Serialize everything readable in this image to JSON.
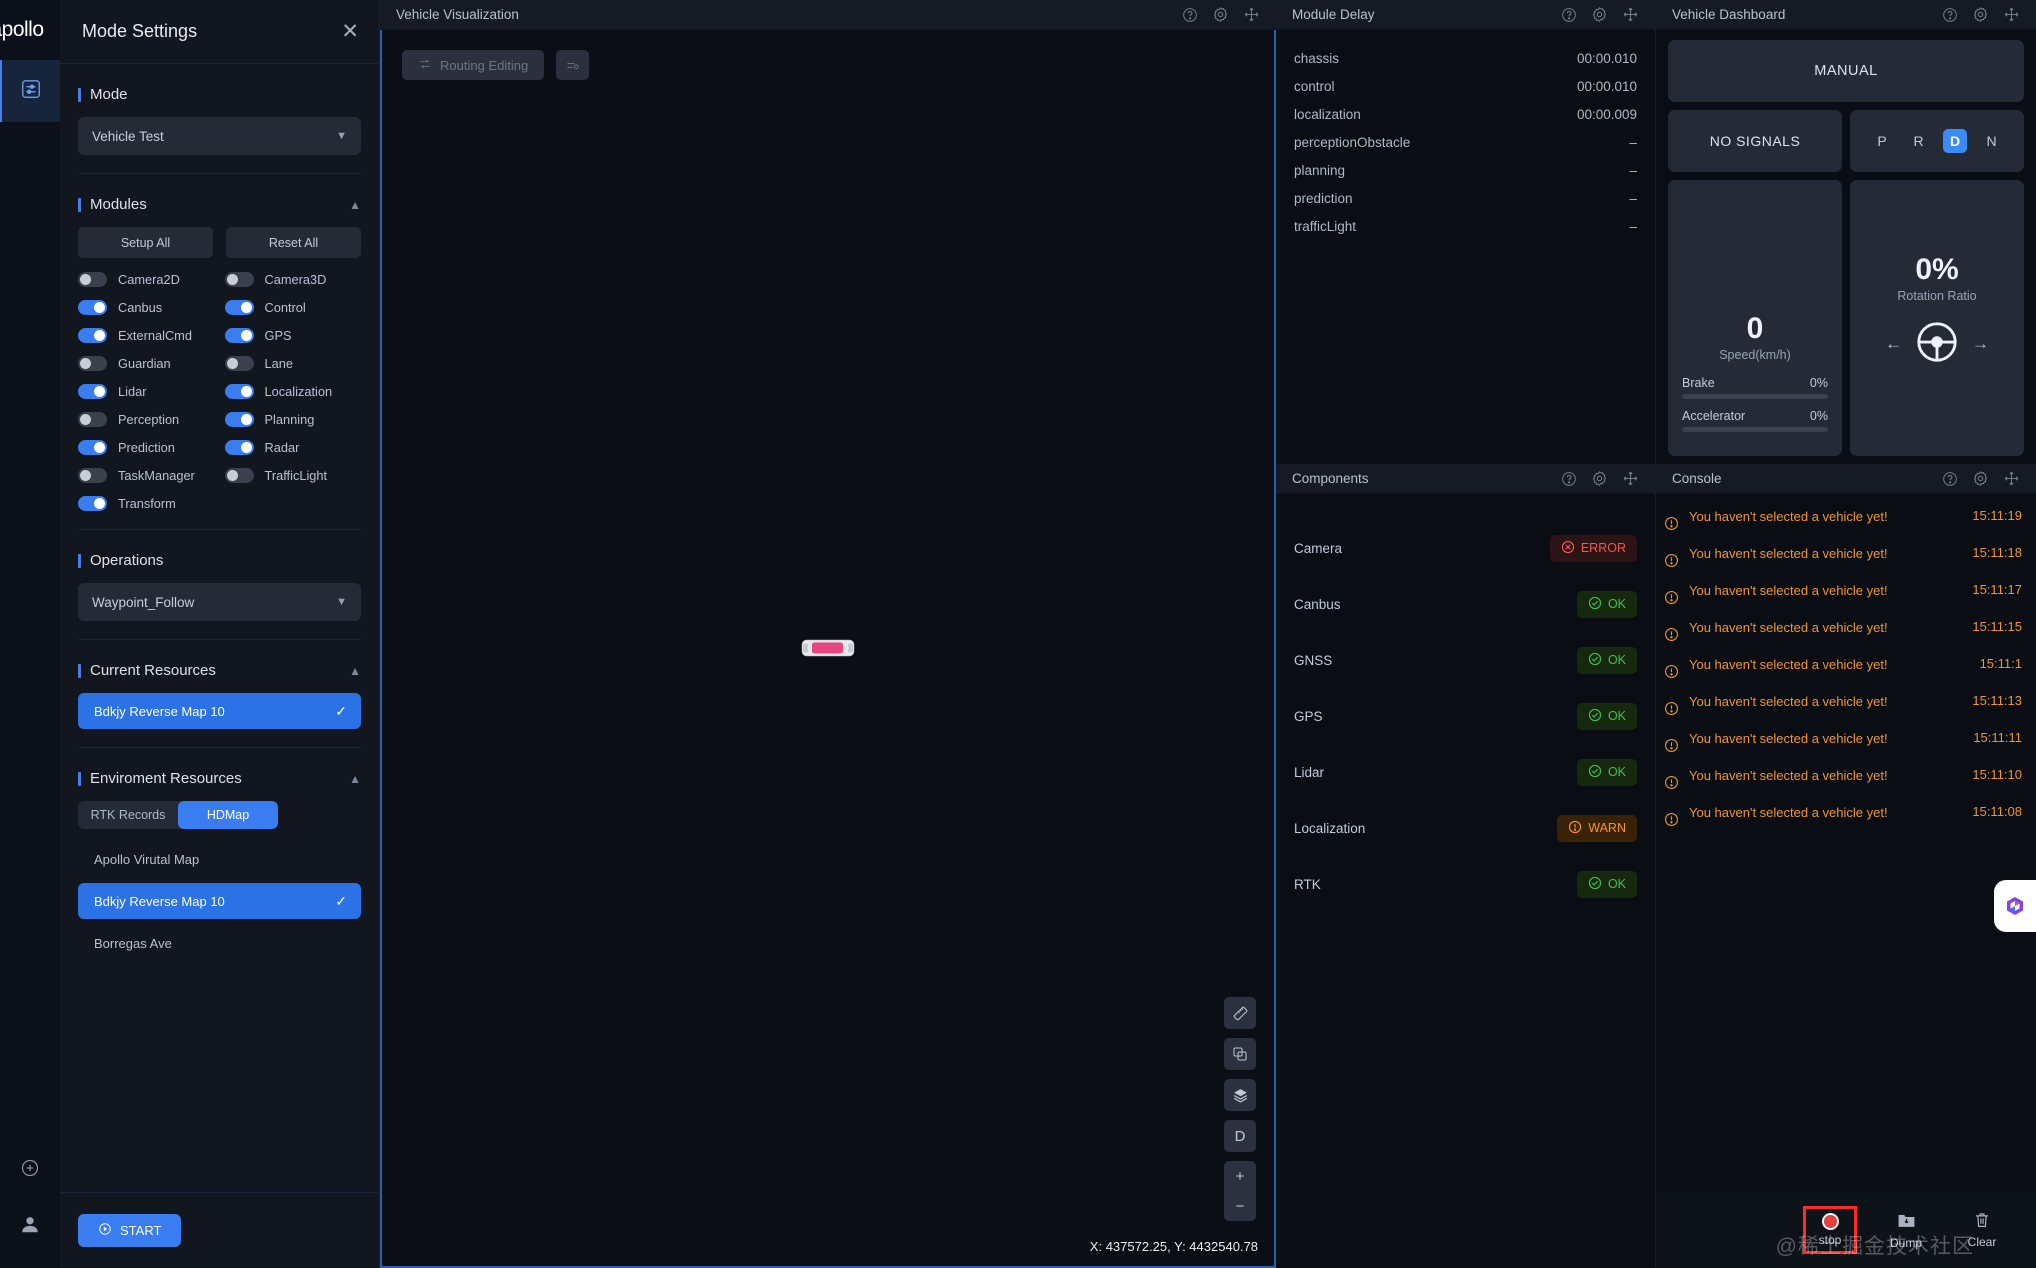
{
  "brand": {
    "logo_text": "apollo"
  },
  "settings": {
    "title": "Mode Settings",
    "close_icon": "close-icon",
    "mode": {
      "section_label": "Mode",
      "value": "Vehicle Test"
    },
    "modules": {
      "section_label": "Modules",
      "setup_all_label": "Setup All",
      "reset_all_label": "Reset All",
      "items": [
        {
          "label": "Camera2D",
          "on": false
        },
        {
          "label": "Camera3D",
          "on": false
        },
        {
          "label": "Canbus",
          "on": true
        },
        {
          "label": "Control",
          "on": true
        },
        {
          "label": "ExternalCmd",
          "on": true
        },
        {
          "label": "GPS",
          "on": true
        },
        {
          "label": "Guardian",
          "on": false
        },
        {
          "label": "Lane",
          "on": false
        },
        {
          "label": "Lidar",
          "on": true
        },
        {
          "label": "Localization",
          "on": true
        },
        {
          "label": "Perception",
          "on": false
        },
        {
          "label": "Planning",
          "on": true
        },
        {
          "label": "Prediction",
          "on": true
        },
        {
          "label": "Radar",
          "on": true
        },
        {
          "label": "TaskManager",
          "on": false
        },
        {
          "label": "TrafficLight",
          "on": false
        },
        {
          "label": "Transform",
          "on": true
        }
      ]
    },
    "operations": {
      "section_label": "Operations",
      "value": "Waypoint_Follow"
    },
    "current_resources": {
      "section_label": "Current Resources",
      "items": [
        {
          "label": "Bdkjy Reverse Map 10",
          "selected": true
        }
      ]
    },
    "environment_resources": {
      "section_label": "Enviroment Resources",
      "tabs": [
        {
          "label": "RTK Records",
          "active": false
        },
        {
          "label": "HDMap",
          "active": true
        }
      ],
      "items": [
        {
          "label": "Apollo Virutal Map",
          "selected": false
        },
        {
          "label": "Bdkjy Reverse Map 10",
          "selected": true
        },
        {
          "label": "Borregas Ave",
          "selected": false
        }
      ]
    },
    "start_label": "START"
  },
  "visualization": {
    "title": "Vehicle Visualization",
    "routing_editing_label": "Routing Editing",
    "coordinates": "X: 437572.25, Y: 4432540.78",
    "side_tools": [
      "ruler-icon",
      "copy-icon",
      "layers-icon",
      "direction-d-icon",
      "zoom-in-icon",
      "zoom-out-icon"
    ],
    "zoom_in": "+",
    "zoom_out": "−",
    "direction_label": "D"
  },
  "module_delay": {
    "title": "Module Delay",
    "rows": [
      {
        "name": "chassis",
        "value": "00:00.010"
      },
      {
        "name": "control",
        "value": "00:00.010"
      },
      {
        "name": "localization",
        "value": "00:00.009"
      },
      {
        "name": "perceptionObstacle",
        "value": "–"
      },
      {
        "name": "planning",
        "value": "–"
      },
      {
        "name": "prediction",
        "value": "–"
      },
      {
        "name": "trafficLight",
        "value": "–"
      }
    ]
  },
  "vehicle_dashboard": {
    "title": "Vehicle Dashboard",
    "drive_mode": "MANUAL",
    "signal": "NO SIGNALS",
    "gears": [
      {
        "label": "P",
        "active": false
      },
      {
        "label": "R",
        "active": false
      },
      {
        "label": "D",
        "active": true
      },
      {
        "label": "N",
        "active": false
      }
    ],
    "speed": {
      "value": "0",
      "label": "Speed(km/h)"
    },
    "rotation": {
      "value": "0%",
      "label": "Rotation Ratio"
    },
    "brake": {
      "label": "Brake",
      "value": "0%",
      "percent": 0
    },
    "accelerator": {
      "label": "Accelerator",
      "value": "0%",
      "percent": 0
    }
  },
  "components": {
    "title": "Components",
    "rows": [
      {
        "name": "Camera",
        "status": "ERROR",
        "kind": "err"
      },
      {
        "name": "Canbus",
        "status": "OK",
        "kind": "ok"
      },
      {
        "name": "GNSS",
        "status": "OK",
        "kind": "ok"
      },
      {
        "name": "GPS",
        "status": "OK",
        "kind": "ok"
      },
      {
        "name": "Lidar",
        "status": "OK",
        "kind": "ok"
      },
      {
        "name": "Localization",
        "status": "WARN",
        "kind": "warn"
      },
      {
        "name": "RTK",
        "status": "OK",
        "kind": "ok"
      }
    ]
  },
  "console": {
    "title": "Console",
    "logs": [
      {
        "message": "You haven't selected a vehicle yet!",
        "time": "15:11:19"
      },
      {
        "message": "You haven't selected a vehicle yet!",
        "time": "15:11:18"
      },
      {
        "message": "You haven't selected a vehicle yet!",
        "time": "15:11:17"
      },
      {
        "message": "You haven't selected a vehicle yet!",
        "time": "15:11:15"
      },
      {
        "message": "You haven't selected a vehicle yet!",
        "time": "15:11:1"
      },
      {
        "message": "You haven't selected a vehicle yet!",
        "time": "15:11:13"
      },
      {
        "message": "You haven't selected a vehicle yet!",
        "time": "15:11:11"
      },
      {
        "message": "You haven't selected a vehicle yet!",
        "time": "15:11:10"
      },
      {
        "message": "You haven't selected a vehicle yet!",
        "time": "15:11:08"
      }
    ]
  },
  "bottom_bar": {
    "stop_label": "stop",
    "dump_label": "Dump",
    "clear_label": "Clear"
  },
  "watermark": "@稀土掘金技术社区",
  "colors": {
    "accent": "#3a7df0",
    "ok": "#3fc24a",
    "error": "#f2564d",
    "warn": "#f79622",
    "panel": "#12161f",
    "background": "#0a0d14"
  }
}
